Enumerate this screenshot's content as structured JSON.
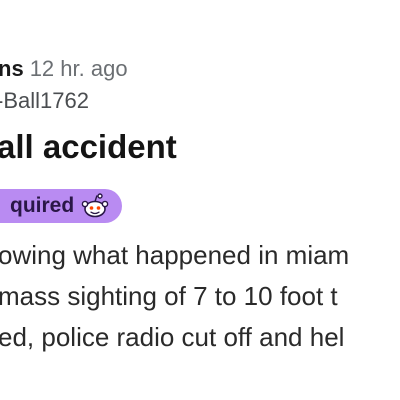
{
  "post": {
    "community": "ns",
    "time": "12 hr. ago",
    "author": "-Ball1762",
    "title": "all accident",
    "flair": {
      "label": "quired",
      "icon": "reddit-snoo-icon",
      "color": "#b98bf2"
    },
    "body_lines": [
      "owing what happened in miam",
      "mass sighting of 7 to 10 foot t",
      "ed, police radio cut off and hel"
    ]
  }
}
